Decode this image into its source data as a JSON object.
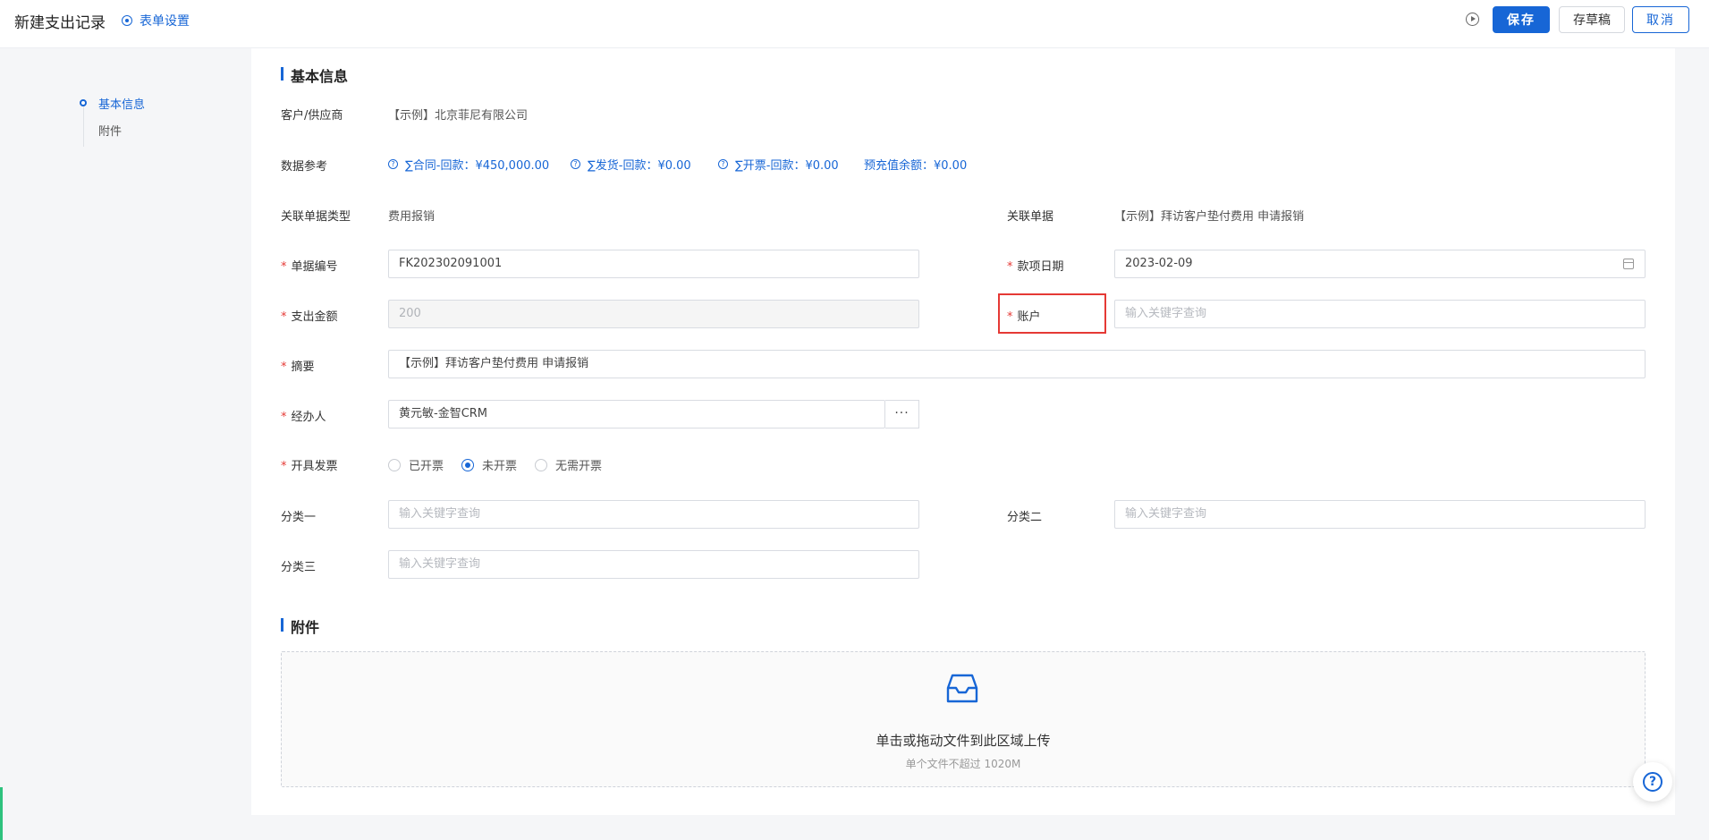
{
  "header": {
    "title": "新建支出记录",
    "form_settings": "表单设置",
    "save": "保存",
    "draft": "存草稿",
    "cancel": "取消"
  },
  "nav": {
    "items": [
      {
        "label": "基本信息",
        "active": true
      },
      {
        "label": "附件",
        "active": false
      }
    ]
  },
  "basic": {
    "section_title": "基本信息",
    "customer": {
      "label": "客户/供应商",
      "value": "【示例】北京菲尼有限公司"
    },
    "reference": {
      "label": "数据参考",
      "items": [
        "∑合同-回款：¥450,000.00",
        "∑发货-回款：¥0.00",
        "∑开票-回款：¥0.00",
        "预充值余额：¥0.00"
      ]
    },
    "related_type": {
      "label": "关联单据类型",
      "value": "费用报销"
    },
    "related_doc": {
      "label": "关联单据",
      "value": "【示例】拜访客户垫付费用 申请报销"
    },
    "doc_no": {
      "label": "单据编号",
      "value": "FK202302091001"
    },
    "date": {
      "label": "款项日期",
      "value": "2023-02-09"
    },
    "amount": {
      "label": "支出金额",
      "value": "200"
    },
    "account": {
      "label": "账户",
      "placeholder": "输入关键字查询"
    },
    "summary": {
      "label": "摘要",
      "value": "【示例】拜访客户垫付费用 申请报销"
    },
    "handler": {
      "label": "经办人",
      "value": "黄元敏-金智CRM",
      "more": "···"
    },
    "invoice": {
      "label": "开具发票",
      "options": [
        "已开票",
        "未开票",
        "无需开票"
      ],
      "selected": "未开票"
    },
    "cat1": {
      "label": "分类一",
      "placeholder": "输入关键字查询"
    },
    "cat2": {
      "label": "分类二",
      "placeholder": "输入关键字查询"
    },
    "cat3": {
      "label": "分类三",
      "placeholder": "输入关键字查询"
    }
  },
  "attachments": {
    "section_title": "附件",
    "upload_text": "单击或拖动文件到此区域上传",
    "upload_hint": "单个文件不超过 1020M"
  },
  "help": "?"
}
